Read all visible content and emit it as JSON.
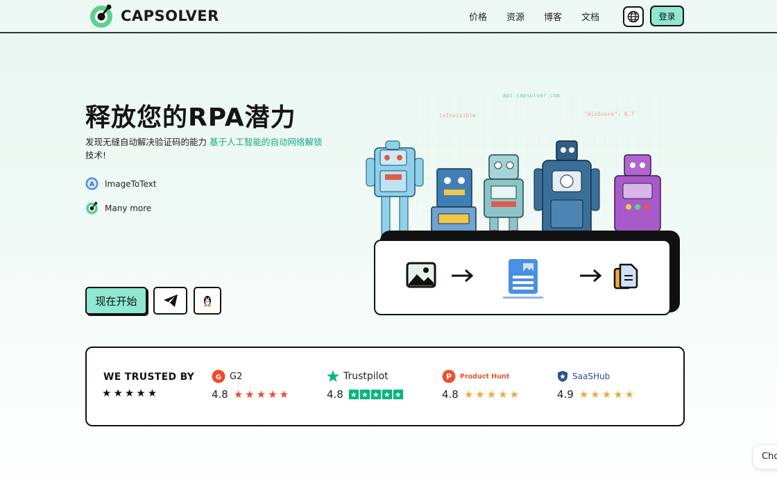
{
  "nav": {
    "brand": "CAPSOLVER",
    "links": [
      "价格",
      "资源",
      "博客",
      "文档"
    ],
    "login": "登录"
  },
  "hero": {
    "title": "释放您的RPA潜力",
    "desc_before": "发现无缝自动解决验证码的能力 ",
    "desc_highlight": "基于人工智能的自动网络解锁",
    "desc_after": " 技术!",
    "features": [
      "ImageToText",
      "Many more"
    ],
    "cta": "现在开始"
  },
  "illustration": {
    "labels": [
      "api.capsolver.com",
      "isInvisible",
      "\"minScore\": 0.7"
    ]
  },
  "trust": {
    "title": "WE TRUSTED BY",
    "stars": "★★★★★",
    "reviews": [
      {
        "name": "G2",
        "score": "4.8",
        "color": "#ef4a2b"
      },
      {
        "name": "Trustpilot",
        "score": "4.8",
        "color": "#00b67a"
      },
      {
        "name": "Product Hunt",
        "score": "4.8",
        "color": "#f2a740"
      },
      {
        "name": "SaaSHub",
        "score": "4.9",
        "color": "#f2a740"
      }
    ]
  },
  "chat": {
    "label": "Cho"
  },
  "colors": {
    "accent": "#8fe8cf",
    "highlight": "#19a882",
    "border": "#111111"
  }
}
